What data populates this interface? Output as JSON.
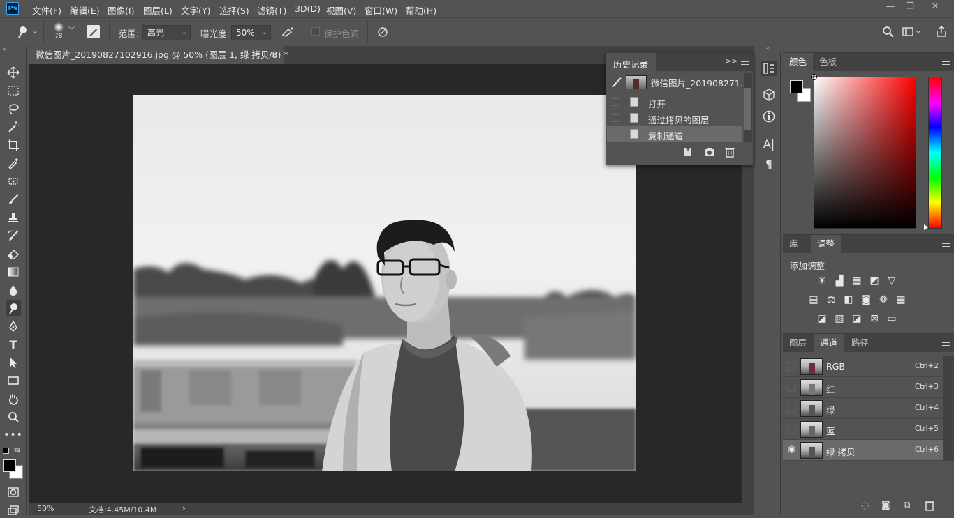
{
  "app": {
    "logo": "Ps"
  },
  "menu": [
    "文件(F)",
    "编辑(E)",
    "图像(I)",
    "图层(L)",
    "文字(Y)",
    "选择(S)",
    "滤镜(T)",
    "3D(D)",
    "视图(V)",
    "窗口(W)",
    "帮助(H)"
  ],
  "window_controls": {
    "minimize": "—",
    "restore": "❐",
    "close": "✕"
  },
  "options": {
    "brush_size": "78",
    "range_label": "范围:",
    "range_value": "高光",
    "exposure_label": "曝光度:",
    "exposure_value": "50%",
    "protect_tones_label": "保护色调"
  },
  "document": {
    "tab_title": "微信图片_20190827102916.jpg @ 50% (图层 1, 绿 拷贝/8) *",
    "tab_close": "×",
    "zoom": "50%",
    "doc_info": "文档:4.45M/10.4M",
    "status_arrow": "›"
  },
  "history": {
    "title": "历史记录",
    "snapshot_name": "微信图片_201908271...",
    "items": [
      {
        "label": "打开"
      },
      {
        "label": "通过拷贝的图层"
      },
      {
        "label": "复制通道"
      }
    ]
  },
  "color_panel": {
    "tabs": [
      "颜色",
      "色板"
    ],
    "foreground": "#000000",
    "background": "#ffffff"
  },
  "adjust_panel": {
    "tabs": [
      "库",
      "调整"
    ],
    "heading": "添加调整"
  },
  "channels_panel": {
    "tabs": [
      "图层",
      "通道",
      "路径"
    ],
    "channels": [
      {
        "name": "RGB",
        "shortcut": "Ctrl+2"
      },
      {
        "name": "红",
        "shortcut": "Ctrl+3"
      },
      {
        "name": "绿",
        "shortcut": "Ctrl+4"
      },
      {
        "name": "蓝",
        "shortcut": "Ctrl+5"
      },
      {
        "name": "绿 拷贝",
        "shortcut": "Ctrl+6"
      }
    ]
  }
}
